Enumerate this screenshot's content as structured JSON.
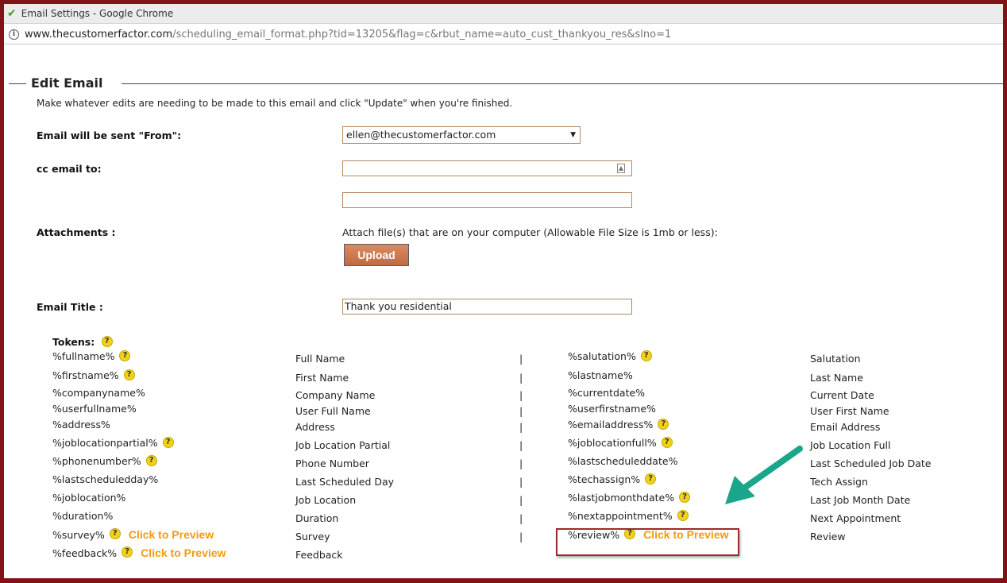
{
  "window": {
    "title": "Email Settings - Google Chrome",
    "url_host": "www.thecustomerfactor.com",
    "url_path": "/scheduling_email_format.php?tid=13205&flag=c&rbut_name=auto_cust_thankyou_res&slno=1"
  },
  "form": {
    "legend": "Edit Email",
    "instructions": "Make whatever edits are needing to be made to this email and click \"Update\" when you're finished.",
    "from_label": "Email will be sent \"From\":",
    "from_value": "ellen@thecustomerfactor.com",
    "cc_label": "cc email to:",
    "cc_value": "",
    "cc_value2": "",
    "attachments_label": "Attachments :",
    "attach_text": "Attach file(s) that are on your computer (Allowable File Size is 1mb or less):",
    "upload_label": "Upload",
    "title_label": "Email Title :",
    "title_value": "Thank you residential"
  },
  "tokens": {
    "label": "Tokens:",
    "help_glyph": "?",
    "separator": "|",
    "preview_label": "Click to Preview",
    "left": [
      {
        "token": "%fullname%",
        "desc": "Full Name",
        "help": true,
        "preview": false
      },
      {
        "token": "%firstname%",
        "desc": "First Name",
        "help": true,
        "preview": false
      },
      {
        "token": "%companyname%",
        "desc": "Company Name",
        "help": false,
        "preview": false
      },
      {
        "token": "%userfullname%",
        "desc": "User Full Name",
        "help": false,
        "preview": false
      },
      {
        "token": "%address%",
        "desc": "Address",
        "help": false,
        "preview": false
      },
      {
        "token": "%joblocationpartial%",
        "desc": "Job Location Partial",
        "help": true,
        "preview": false
      },
      {
        "token": "%phonenumber%",
        "desc": "Phone Number",
        "help": true,
        "preview": false
      },
      {
        "token": "%lastscheduledday%",
        "desc": "Last Scheduled Day",
        "help": false,
        "preview": false
      },
      {
        "token": "%joblocation%",
        "desc": "Job Location",
        "help": false,
        "preview": false
      },
      {
        "token": "%duration%",
        "desc": "Duration",
        "help": false,
        "preview": false
      },
      {
        "token": "%survey%",
        "desc": "Survey",
        "help": true,
        "preview": true
      },
      {
        "token": "%feedback%",
        "desc": "Feedback",
        "help": true,
        "preview": true
      }
    ],
    "right": [
      {
        "token": "%salutation%",
        "desc": "Salutation",
        "help": true,
        "preview": false
      },
      {
        "token": "%lastname%",
        "desc": "Last Name",
        "help": false,
        "preview": false
      },
      {
        "token": "%currentdate%",
        "desc": "Current Date",
        "help": false,
        "preview": false
      },
      {
        "token": "%userfirstname%",
        "desc": "User First Name",
        "help": false,
        "preview": false
      },
      {
        "token": "%emailaddress%",
        "desc": "Email Address",
        "help": true,
        "preview": false
      },
      {
        "token": "%joblocationfull%",
        "desc": "Job Location Full",
        "help": true,
        "preview": false
      },
      {
        "token": "%lastscheduleddate%",
        "desc": "Last Scheduled Job Date",
        "help": false,
        "preview": false
      },
      {
        "token": "%techassign%",
        "desc": "Tech Assign",
        "help": true,
        "preview": false
      },
      {
        "token": "%lastjobmonthdate%",
        "desc": "Last Job Month Date",
        "help": true,
        "preview": false
      },
      {
        "token": "%nextappointment%",
        "desc": "Next Appointment",
        "help": true,
        "preview": false
      },
      {
        "token": "%review%",
        "desc": "Review",
        "help": true,
        "preview": true
      }
    ]
  },
  "colors": {
    "frame": "#7f1416",
    "preview_link": "#f29a11",
    "annotation_arrow": "#1aa68a",
    "highlight_box": "#9c2b2b"
  }
}
